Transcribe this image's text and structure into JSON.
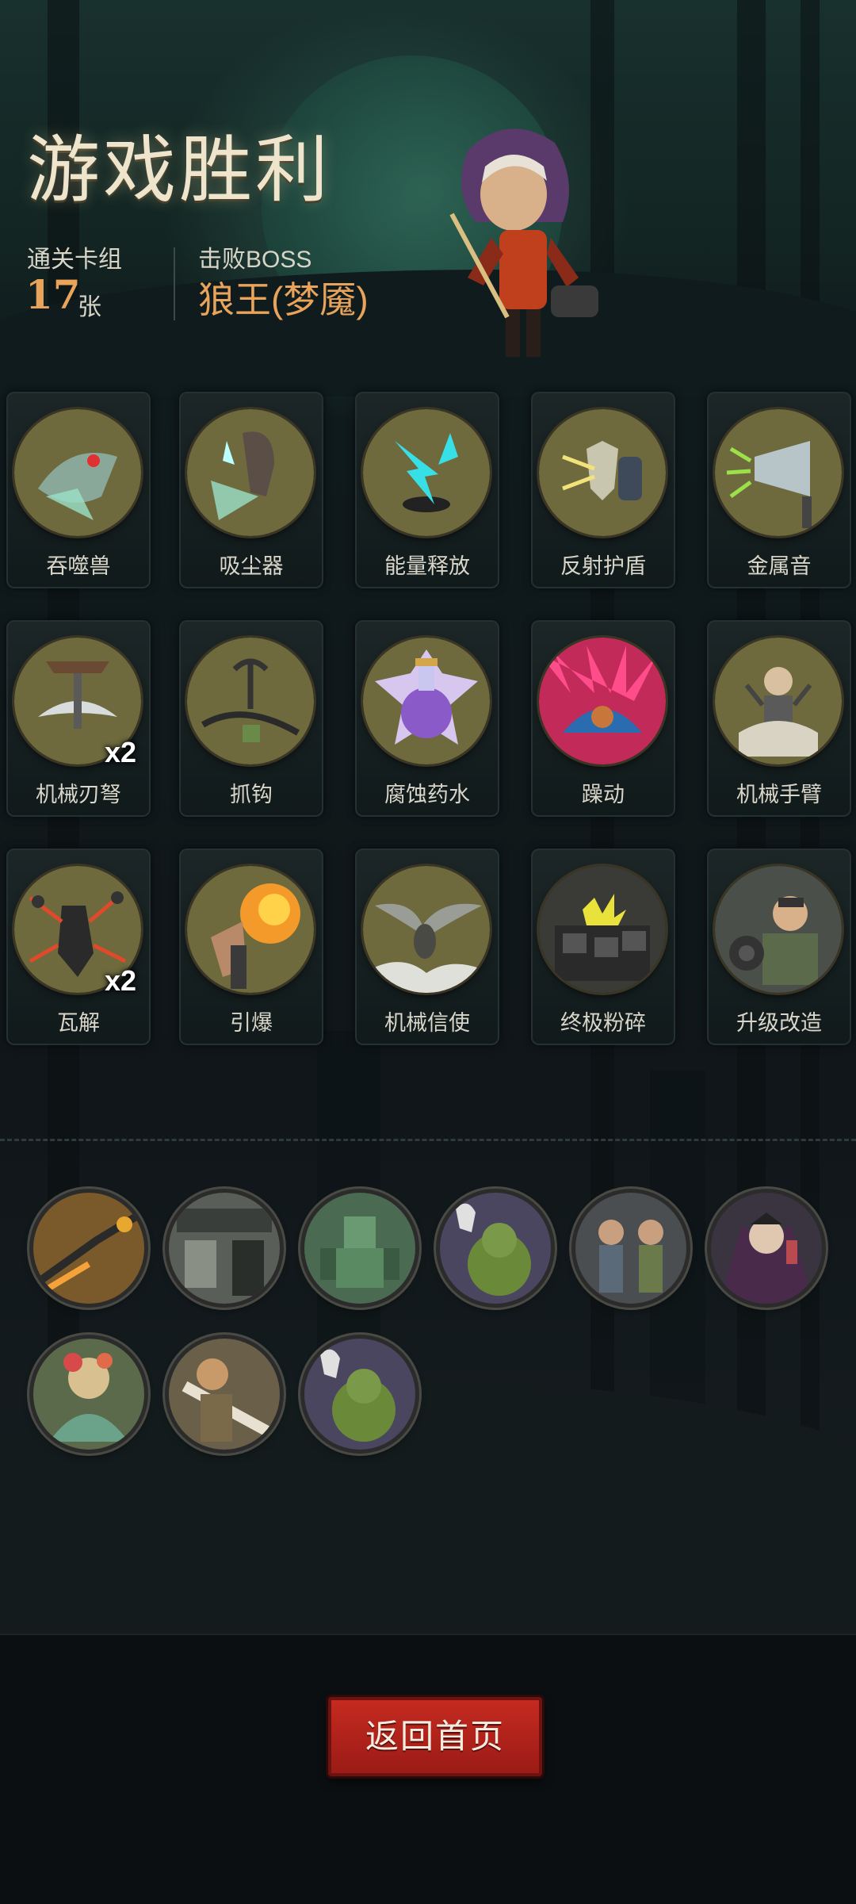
{
  "result": {
    "title": "游戏胜利",
    "deck_label": "通关卡组",
    "deck_count": "17",
    "deck_unit": "张",
    "boss_label": "击败BOSS",
    "boss_name": "狼王(梦魇)"
  },
  "cards": [
    {
      "label": "吞噬兽",
      "icon": "devourer-beast-icon",
      "multiplier": "",
      "tone": "#5a8a7a"
    },
    {
      "label": "吸尘器",
      "icon": "vacuum-icon",
      "multiplier": "",
      "tone": "#6aa392"
    },
    {
      "label": "能量释放",
      "icon": "energy-release-icon",
      "multiplier": "",
      "tone": "#2fc0c8"
    },
    {
      "label": "反射护盾",
      "icon": "reflect-shield-icon",
      "multiplier": "",
      "tone": "#c9b86a"
    },
    {
      "label": "金属音",
      "icon": "metal-sound-icon",
      "multiplier": "",
      "tone": "#8bc34a"
    },
    {
      "label": "机械刃弩",
      "icon": "mech-blade-crossbow-icon",
      "multiplier": "x2",
      "tone": "#9aa0a0"
    },
    {
      "label": "抓钩",
      "icon": "grappling-hook-icon",
      "multiplier": "",
      "tone": "#7d8a70"
    },
    {
      "label": "腐蚀药水",
      "icon": "corrosion-potion-icon",
      "multiplier": "",
      "tone": "#9b6fd6"
    },
    {
      "label": "躁动",
      "icon": "frenzy-icon",
      "multiplier": "",
      "tone": "#e03a7a"
    },
    {
      "label": "机械手臂",
      "icon": "mech-arm-icon",
      "multiplier": "",
      "tone": "#b9b3a0"
    },
    {
      "label": "瓦解",
      "icon": "disintegrate-icon",
      "multiplier": "x2",
      "tone": "#e0502a"
    },
    {
      "label": "引爆",
      "icon": "detonate-icon",
      "multiplier": "",
      "tone": "#f08a25"
    },
    {
      "label": "机械信使",
      "icon": "mech-messenger-icon",
      "multiplier": "",
      "tone": "#9a9d96"
    },
    {
      "label": "终极粉碎",
      "icon": "ultimate-crush-icon",
      "multiplier": "",
      "tone": "#d9d23a"
    },
    {
      "label": "升级改造",
      "icon": "upgrade-icon",
      "multiplier": "",
      "tone": "#7d8a86"
    }
  ],
  "defeated": [
    {
      "icon": "scorpion-enemy-icon",
      "tone": "#c8862f"
    },
    {
      "icon": "workshop-enemy-icon",
      "tone": "#8a8f85"
    },
    {
      "icon": "golem-enemy-icon",
      "tone": "#5a8f6a"
    },
    {
      "icon": "ogre-ghost-enemy-icon",
      "tone": "#7a9a4a"
    },
    {
      "icon": "bandits-enemy-icon",
      "tone": "#6f7a80"
    },
    {
      "icon": "vampire-enemy-icon",
      "tone": "#b84a50"
    },
    {
      "icon": "dryad-enemy-icon",
      "tone": "#6aa38a"
    },
    {
      "icon": "warrior-enemy-icon",
      "tone": "#b89a6a"
    },
    {
      "icon": "ogre-ghost-enemy-icon",
      "tone": "#7a9a4a"
    }
  ],
  "actions": {
    "home_label": "返回首页"
  }
}
